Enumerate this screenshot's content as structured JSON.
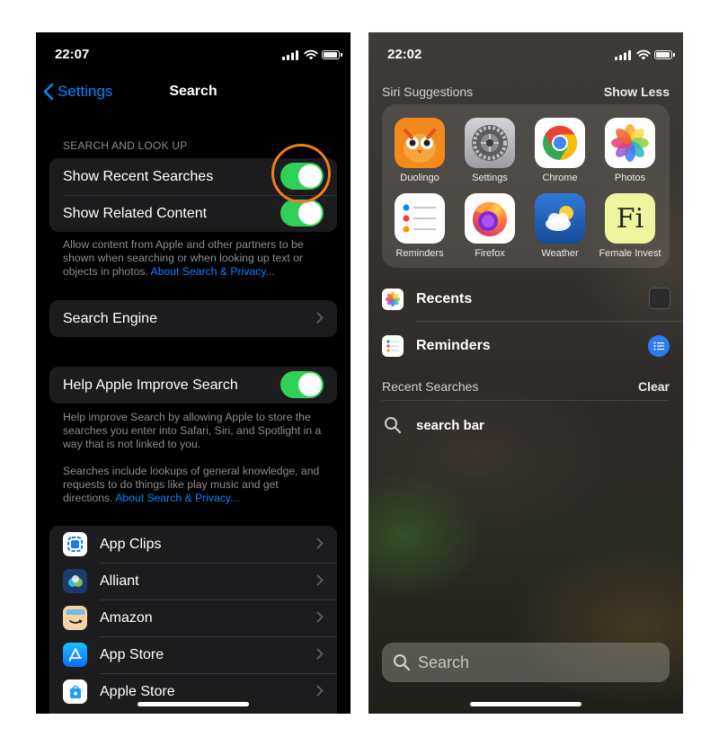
{
  "left": {
    "status": {
      "time": "22:07"
    },
    "nav": {
      "back_label": "Settings",
      "title": "Search"
    },
    "section_header": "SEARCH AND LOOK UP",
    "toggles": [
      {
        "label": "Show Recent Searches",
        "on": true
      },
      {
        "label": "Show Related Content",
        "on": true
      }
    ],
    "footnote1": {
      "text": "Allow content from Apple and other partners to be shown when searching or when looking up text or objects in photos. ",
      "link": "About Search & Privacy..."
    },
    "search_engine_label": "Search Engine",
    "help_improve": {
      "label": "Help Apple Improve Search",
      "on": true
    },
    "footnote2": {
      "text_a": "Help improve Search by allowing Apple to store the searches you enter into Safari, Siri, and Spotlight in a way that is not linked to you.",
      "text_b": "Searches include lookups of general knowledge, and requests to do things like play music and get directions. ",
      "link": "About Search & Privacy..."
    },
    "apps": [
      "App Clips",
      "Alliant",
      "Amazon",
      "App Store",
      "Apple Store"
    ],
    "colors": {
      "accent": "#0a84ff",
      "toggle_on": "#30d158",
      "highlight": "#f07d1b"
    }
  },
  "right": {
    "status": {
      "time": "22:02"
    },
    "siri_header": "Siri Suggestions",
    "show_less": "Show Less",
    "suggested_apps": [
      {
        "label": "Duolingo",
        "icon": "duolingo-icon"
      },
      {
        "label": "Settings",
        "icon": "settings-icon"
      },
      {
        "label": "Chrome",
        "icon": "chrome-icon"
      },
      {
        "label": "Photos",
        "icon": "photos-icon"
      },
      {
        "label": "Reminders",
        "icon": "reminders-icon"
      },
      {
        "label": "Firefox",
        "icon": "firefox-icon"
      },
      {
        "label": "Weather",
        "icon": "weather-icon"
      },
      {
        "label": "Female Invest",
        "icon": "female-invest-icon",
        "glyph": "Fi"
      }
    ],
    "results": [
      {
        "label": "Recents",
        "icon": "photos-icon"
      },
      {
        "label": "Reminders",
        "icon": "reminders-icon"
      }
    ],
    "recent_searches_header": "Recent Searches",
    "clear_label": "Clear",
    "recent_search": "search bar",
    "search_placeholder": "Search"
  }
}
